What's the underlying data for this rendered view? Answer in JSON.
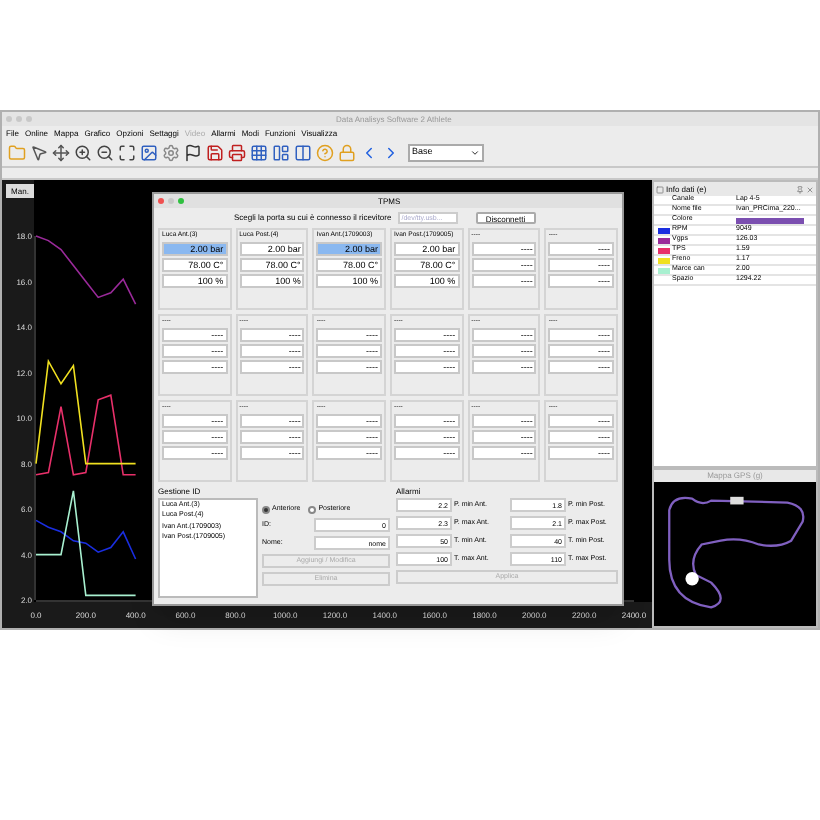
{
  "window": {
    "title": "Data Analisys Software 2 Athlete"
  },
  "menu": [
    {
      "label": "File",
      "disabled": false
    },
    {
      "label": "Online",
      "disabled": false
    },
    {
      "label": "Mappa",
      "disabled": false
    },
    {
      "label": "Grafico",
      "disabled": false
    },
    {
      "label": "Opzioni",
      "disabled": false
    },
    {
      "label": "Settaggi",
      "disabled": false
    },
    {
      "label": "Video",
      "disabled": true
    },
    {
      "label": "Allarmi",
      "disabled": false
    },
    {
      "label": "Modi",
      "disabled": false
    },
    {
      "label": "Funzioni",
      "disabled": false
    },
    {
      "label": "Visualizza",
      "disabled": false
    }
  ],
  "toolbar": {
    "layout_select": "Base"
  },
  "chart": {
    "mode_button": "Man.",
    "chart_data": {
      "type": "line",
      "x": [
        0,
        50,
        100,
        150,
        200,
        250,
        300,
        350,
        400
      ],
      "xlim": [
        0,
        2400
      ],
      "ylim": [
        2,
        18
      ],
      "xticks": [
        {
          "value": 0,
          "label": "0.0"
        },
        {
          "value": 200,
          "label": "200.0"
        },
        {
          "value": 400,
          "label": "400.0"
        },
        {
          "value": 600,
          "label": "600.0"
        },
        {
          "value": 800,
          "label": "800.0"
        },
        {
          "value": 1000,
          "label": "1000.0"
        },
        {
          "value": 1200,
          "label": "1200.0"
        },
        {
          "value": 1400,
          "label": "1400.0"
        },
        {
          "value": 1600,
          "label": "1600.0"
        },
        {
          "value": 1800,
          "label": "1800.0"
        },
        {
          "value": 2000,
          "label": "2000.0"
        },
        {
          "value": 2200,
          "label": "2200.0"
        },
        {
          "value": 2400,
          "label": "2400.0"
        }
      ],
      "yticks": [
        {
          "value": 18,
          "label": "18.0"
        },
        {
          "value": 16,
          "label": "16.0"
        },
        {
          "value": 14,
          "label": "14.0"
        },
        {
          "value": 12,
          "label": "12.0"
        },
        {
          "value": 10,
          "label": "10.0"
        },
        {
          "value": 8,
          "label": "8.0"
        },
        {
          "value": 6,
          "label": "6.0"
        },
        {
          "value": 4,
          "label": "4.0"
        },
        {
          "value": 2,
          "label": "2.0"
        }
      ],
      "series": [
        {
          "color": "#9a2a9a",
          "values": [
            18.0,
            17.8,
            17.4,
            16.7,
            16.0,
            15.3,
            15.5,
            16.1,
            15.0
          ]
        },
        {
          "color": "#e8306a",
          "values": [
            7.5,
            7.6,
            10.5,
            7.5,
            7.6,
            10.8,
            11.0,
            7.5,
            7.5
          ]
        },
        {
          "color": "#f0e020",
          "values": [
            8.0,
            12.5,
            11.5,
            12.3,
            8.0,
            8.0,
            8.0,
            8.0,
            8.0
          ]
        },
        {
          "color": "#1a2ee0",
          "values": [
            5.5,
            5.2,
            5.0,
            4.6,
            4.5,
            4.1,
            4.3,
            5.0,
            3.8
          ]
        },
        {
          "color": "#a8f0d0",
          "values": [
            4.0,
            4.0,
            4.0,
            6.8,
            2.2,
            2.2,
            2.2,
            2.2,
            2.2
          ]
        }
      ]
    }
  },
  "tpms_dialog": {
    "title": "TPMS",
    "port_label": "Scegli la porta su cui è connesso il ricevitore",
    "port_select": "/dev/tty.usb...",
    "disconnect_button": "Disconnetti",
    "sensors": [
      {
        "name": "Luca Ant.(3)",
        "pressure": "2.00 bar",
        "temperature": "78.00 C°",
        "battery": "100 %",
        "selected": true
      },
      {
        "name": "Luca Post.(4)",
        "pressure": "2.00 bar",
        "temperature": "78.00 C°",
        "battery": "100 %",
        "selected": false
      },
      {
        "name": "Ivan Ant.(1709003)",
        "pressure": "2.00 bar",
        "temperature": "78.00 C°",
        "battery": "100 %",
        "selected": true
      },
      {
        "name": "Ivan Post.(1709005)",
        "pressure": "2.00 bar",
        "temperature": "78.00 C°",
        "battery": "100 %",
        "selected": false
      },
      {
        "name": "----",
        "pressure": "----",
        "temperature": "----",
        "battery": "----",
        "selected": false
      },
      {
        "name": "----",
        "pressure": "----",
        "temperature": "----",
        "battery": "----",
        "selected": false
      },
      {
        "name": "----",
        "pressure": "----",
        "temperature": "----",
        "battery": "----",
        "selected": false
      },
      {
        "name": "----",
        "pressure": "----",
        "temperature": "----",
        "battery": "----",
        "selected": false
      },
      {
        "name": "----",
        "pressure": "----",
        "temperature": "----",
        "battery": "----",
        "selected": false
      },
      {
        "name": "----",
        "pressure": "----",
        "temperature": "----",
        "battery": "----",
        "selected": false
      },
      {
        "name": "----",
        "pressure": "----",
        "temperature": "----",
        "battery": "----",
        "selected": false
      },
      {
        "name": "----",
        "pressure": "----",
        "temperature": "----",
        "battery": "----",
        "selected": false
      },
      {
        "name": "----",
        "pressure": "----",
        "temperature": "----",
        "battery": "----",
        "selected": false
      },
      {
        "name": "----",
        "pressure": "----",
        "temperature": "----",
        "battery": "----",
        "selected": false
      },
      {
        "name": "----",
        "pressure": "----",
        "temperature": "----",
        "battery": "----",
        "selected": false
      },
      {
        "name": "----",
        "pressure": "----",
        "temperature": "----",
        "battery": "----",
        "selected": false
      },
      {
        "name": "----",
        "pressure": "----",
        "temperature": "----",
        "battery": "----",
        "selected": false
      },
      {
        "name": "----",
        "pressure": "----",
        "temperature": "----",
        "battery": "----",
        "selected": false
      }
    ],
    "id_management": {
      "title": "Gestione ID",
      "ids": [
        "Luca Ant.(3)",
        "Luca Post.(4)",
        "Ivan Ant.(1709003)",
        "Ivan Post.(1709005)"
      ],
      "positions": [
        {
          "label": "Anteriore",
          "selected": true
        },
        {
          "label": "Posteriore",
          "selected": false
        }
      ],
      "id_label": "ID:",
      "id_value": "0",
      "name_label": "Nome:",
      "name_value": "nome",
      "buttons": [
        {
          "label": "Aggiungi / Modifica",
          "disabled": true
        },
        {
          "label": "Elimina",
          "disabled": true
        }
      ]
    },
    "alarms": {
      "title": "Allarmi",
      "fields": [
        {
          "value": "2.2",
          "label": "P. min Ant."
        },
        {
          "value": "1.8",
          "label": "P. min Post."
        },
        {
          "value": "2.3",
          "label": "P. max Ant."
        },
        {
          "value": "2.1",
          "label": "P. max Post."
        },
        {
          "value": "50",
          "label": "T. min Ant."
        },
        {
          "value": "40",
          "label": "T. min Post."
        },
        {
          "value": "100",
          "label": "T. max Ant."
        },
        {
          "value": "110",
          "label": "T. max Post."
        }
      ],
      "apply_button": {
        "label": "Applica",
        "disabled": true
      }
    }
  },
  "info_panel": {
    "title": "Info dati (e)",
    "rows": [
      {
        "name": "Canale",
        "value": "Lap 4-5"
      },
      {
        "name": "Nome file",
        "value": "Ivan_PRCima_220..."
      },
      {
        "name": "Colore",
        "color": "#7b4fb0"
      },
      {
        "name": "RPM",
        "value": "9049",
        "color": "#1a2ee0"
      },
      {
        "name": "Vgps",
        "value": "126.03",
        "color": "#9a2a9a"
      },
      {
        "name": "TPS",
        "value": "1.59",
        "color": "#e8306a"
      },
      {
        "name": "Freno",
        "value": "1.17",
        "color": "#f0e020"
      },
      {
        "name": "Marce can",
        "value": "2.00",
        "color": "#a8f0d0"
      },
      {
        "name": "Spazio",
        "value": "1294.22"
      }
    ]
  },
  "gps_panel": {
    "title": "Mappa GPS (g)"
  }
}
